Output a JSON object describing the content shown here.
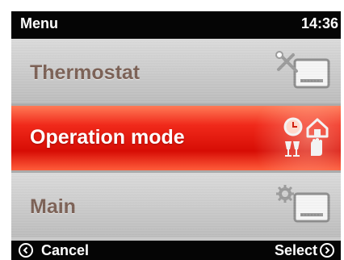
{
  "header": {
    "title": "Menu",
    "time": "14:36"
  },
  "menu": {
    "items": [
      {
        "label": "Thermostat",
        "icon": "thermostat-tools-icon",
        "selected": false
      },
      {
        "label": "Operation mode",
        "icon": "operation-mode-icon",
        "selected": true
      },
      {
        "label": "Main",
        "icon": "main-settings-icon",
        "selected": false
      }
    ]
  },
  "footer": {
    "left_label": "Cancel",
    "right_label": "Select"
  },
  "colors": {
    "selected_red": "#e0180f",
    "label_brown": "#7a5e52",
    "bar_black": "#050505"
  }
}
